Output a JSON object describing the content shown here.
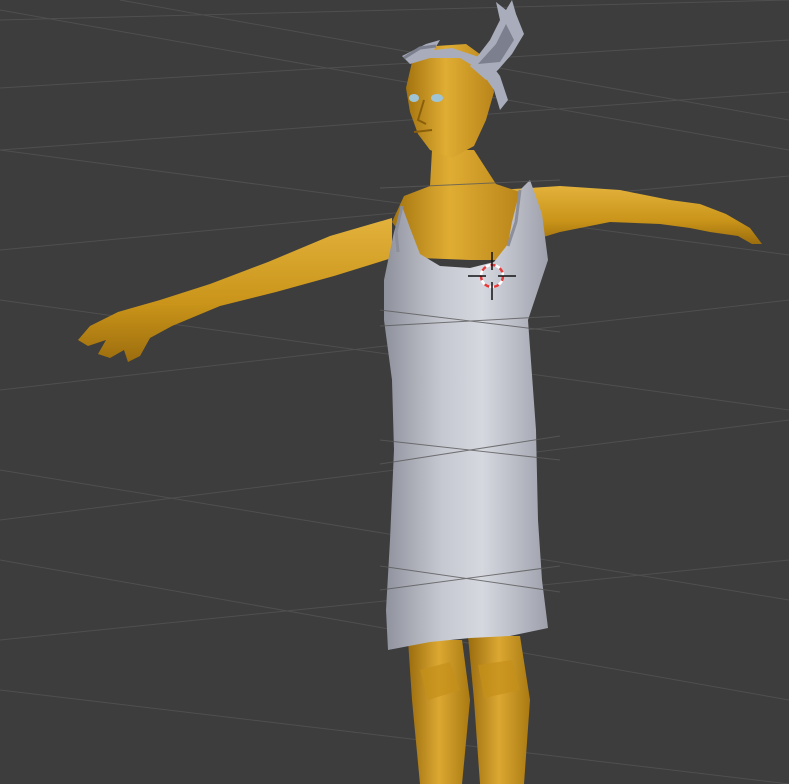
{
  "viewport": {
    "background": "#3d3d3d",
    "grid_color": "#4f4f4f",
    "overlay_grid_color": "#5a5a5a"
  },
  "scene": {
    "figure": {
      "skin_color": "#d19b1f",
      "skin_shadow": "#a3730f",
      "skin_highlight": "#e3b23c"
    },
    "dress": {
      "color": "#b9bcc6",
      "shadow": "#8c8f99",
      "highlight": "#d8dae2"
    },
    "helmet": {
      "color": "#a9adbb",
      "shadow": "#7b7f8e"
    },
    "eyes_color": "#9fc4d6"
  },
  "cursor": {
    "icon": "3d-cursor-icon",
    "ring_red": "#e63a3a",
    "ring_white": "#ffffff",
    "crosshair": "#111111"
  }
}
